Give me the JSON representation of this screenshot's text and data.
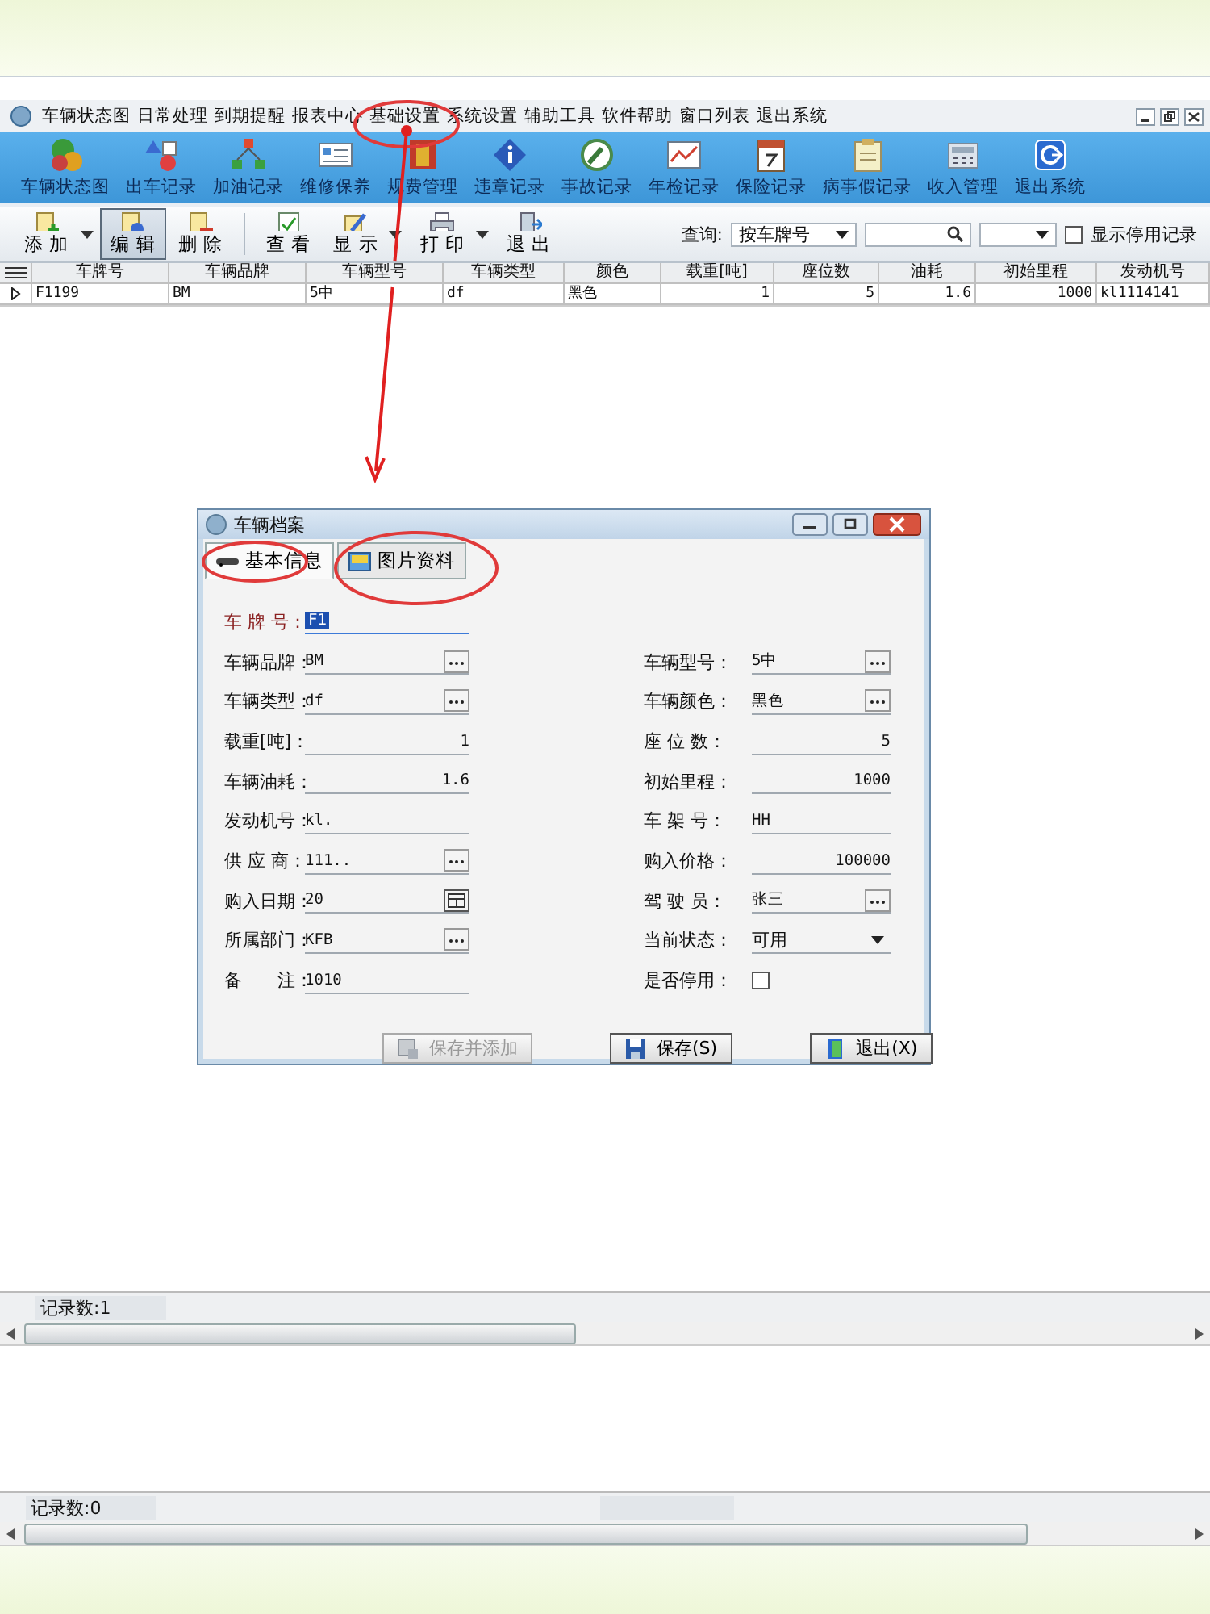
{
  "menu_bar": {
    "items": [
      "车辆状态图",
      "日常处理",
      "到期提醒",
      "报表中心",
      "基础设置",
      "系统设置",
      "辅助工具",
      "软件帮助",
      "窗口列表",
      "退出系统"
    ]
  },
  "ribbon": {
    "items": [
      "车辆状态图",
      "出车记录",
      "加油记录",
      "维修保养",
      "规费管理",
      "违章记录",
      "事故记录",
      "年检记录",
      "保险记录",
      "病事假记录",
      "收入管理",
      "退出系统"
    ]
  },
  "toolbar": {
    "buttons": [
      {
        "label": "添 加",
        "dropdown": true,
        "selected": false
      },
      {
        "label": "编 辑",
        "dropdown": false,
        "selected": true
      },
      {
        "label": "删 除",
        "dropdown": false,
        "selected": false
      },
      {
        "label": "查 看",
        "dropdown": false,
        "selected": false
      },
      {
        "label": "显 示",
        "dropdown": true,
        "selected": false
      },
      {
        "label": "打 印",
        "dropdown": true,
        "selected": false
      },
      {
        "label": "退 出",
        "dropdown": false,
        "selected": false
      }
    ],
    "query_label": "查询:",
    "query_field": "按车牌号",
    "show_disabled": {
      "label": "显示停用记录",
      "checked": false
    }
  },
  "table": {
    "columns": [
      "车牌号",
      "车辆品牌",
      "车辆型号",
      "车辆类型",
      "颜色",
      "载重[吨]",
      "座位数",
      "油耗",
      "初始里程",
      "发动机号"
    ],
    "rows": [
      {
        "current": true,
        "cells": [
          "F1199",
          "BM",
          "5中",
          "df",
          "黑色",
          "1",
          "5",
          "1.6",
          "1000",
          "kl1114141"
        ]
      }
    ]
  },
  "status_bar": {
    "record_count": "记录数:1"
  },
  "dialog": {
    "title": "车辆档案",
    "tabs": [
      {
        "label": "基本信息",
        "selected": true
      },
      {
        "label": "图片资料",
        "selected": false
      }
    ],
    "rows": [
      {
        "fields": [
          {
            "label": "车 牌 号：",
            "value": "F1",
            "kind": "text",
            "required": true,
            "focused": true
          }
        ]
      },
      {
        "fields": [
          {
            "label": "车辆品牌：",
            "value": "BM",
            "kind": "picker",
            "required": false,
            "focused": false
          },
          {
            "label": "车辆型号：",
            "value": "5中",
            "kind": "picker",
            "required": false,
            "focused": false
          }
        ]
      },
      {
        "fields": [
          {
            "label": "车辆类型：",
            "value": "df",
            "kind": "picker",
            "required": false,
            "focused": false
          },
          {
            "label": "车辆颜色：",
            "value": "黑色",
            "kind": "picker",
            "required": false,
            "focused": false
          }
        ]
      },
      {
        "fields": [
          {
            "label": "载重[吨]：",
            "value": "1",
            "kind": "number",
            "required": false,
            "focused": false
          },
          {
            "label": "座 位 数：",
            "value": "5",
            "kind": "number",
            "required": false,
            "focused": false
          }
        ]
      },
      {
        "fields": [
          {
            "label": "车辆油耗：",
            "value": "1.6",
            "kind": "number",
            "required": false,
            "focused": false
          },
          {
            "label": "初始里程：",
            "value": "1000",
            "kind": "number",
            "required": false,
            "focused": false
          }
        ]
      },
      {
        "fields": [
          {
            "label": "发动机号：",
            "value": "kl.",
            "kind": "text",
            "required": false,
            "focused": false
          },
          {
            "label": "车 架 号：",
            "value": "HH",
            "kind": "text",
            "required": false,
            "focused": false
          }
        ]
      },
      {
        "fields": [
          {
            "label": "供 应 商：",
            "value": "111..",
            "kind": "picker",
            "required": false,
            "focused": false
          },
          {
            "label": "购入价格：",
            "value": "100000",
            "kind": "number",
            "required": false,
            "focused": false
          }
        ]
      },
      {
        "fields": [
          {
            "label": "购入日期：",
            "value": "20",
            "kind": "date",
            "required": false,
            "focused": false
          },
          {
            "label": "驾 驶 员：",
            "value": "张三",
            "kind": "picker",
            "required": false,
            "focused": false
          }
        ]
      },
      {
        "fields": [
          {
            "label": "所属部门：",
            "value": "KFB",
            "kind": "picker",
            "required": false,
            "focused": false
          },
          {
            "label": "当前状态：",
            "value": "可用",
            "kind": "select",
            "required": false,
            "focused": false
          }
        ]
      },
      {
        "fields": [
          {
            "label": "备　　注：",
            "value": "1010",
            "kind": "text",
            "required": false,
            "focused": false
          },
          {
            "label": "是否停用：",
            "checked": false,
            "kind": "checkbox",
            "required": false,
            "focused": false
          }
        ]
      }
    ],
    "buttons": [
      {
        "label": "保存并添加",
        "disabled": true,
        "kind": "add"
      },
      {
        "label": "保存(S)",
        "disabled": false,
        "kind": "save"
      },
      {
        "label": "退出(X)",
        "disabled": false,
        "kind": "exit"
      }
    ]
  },
  "outer_status_bar": {
    "record_count": "记录数:0"
  }
}
